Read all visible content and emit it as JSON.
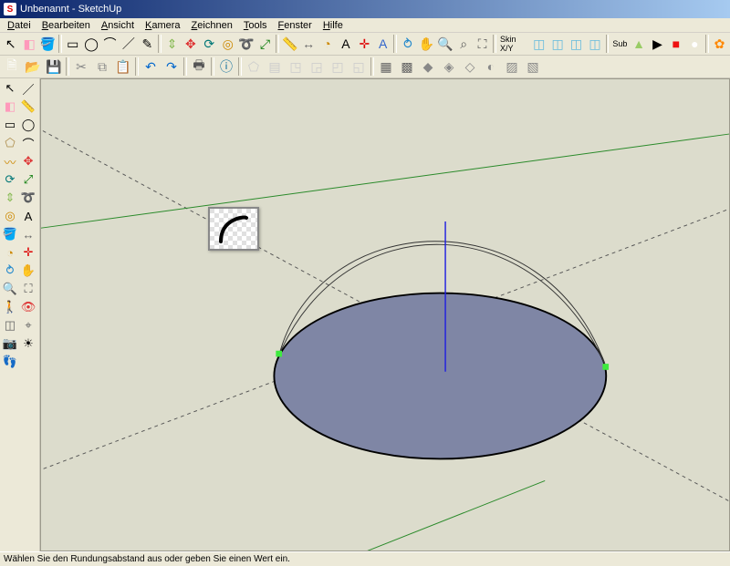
{
  "titlebar": {
    "app_icon": "S",
    "title": "Unbenannt - SketchUp"
  },
  "menu": {
    "items": [
      {
        "label": "Datei",
        "ul": "D"
      },
      {
        "label": "Bearbeiten",
        "ul": "B"
      },
      {
        "label": "Ansicht",
        "ul": "A"
      },
      {
        "label": "Kamera",
        "ul": "K"
      },
      {
        "label": "Zeichnen",
        "ul": "Z"
      },
      {
        "label": "Tools",
        "ul": "T"
      },
      {
        "label": "Fenster",
        "ul": "F"
      },
      {
        "label": "Hilfe",
        "ul": "H"
      }
    ]
  },
  "toolbar1": {
    "groups": [
      {
        "label": "",
        "tools": [
          {
            "name": "select-arrow",
            "glyph": "↖",
            "color": "#000"
          },
          {
            "name": "eraser",
            "glyph": "◧",
            "color": "#f9b"
          },
          {
            "name": "paint-bucket",
            "glyph": "🪣",
            "color": "#c96"
          }
        ]
      },
      {
        "tools": [
          {
            "name": "rectangle",
            "glyph": "▭",
            "color": "#000"
          },
          {
            "name": "circle",
            "glyph": "◯",
            "color": "#000"
          },
          {
            "name": "arc",
            "glyph": "⌒",
            "color": "#000"
          },
          {
            "name": "line",
            "glyph": "／",
            "color": "#000"
          },
          {
            "name": "freehand",
            "glyph": "✎",
            "color": "#000"
          }
        ]
      },
      {
        "tools": [
          {
            "name": "push-pull",
            "glyph": "⇕",
            "color": "#8b5"
          },
          {
            "name": "move",
            "glyph": "✥",
            "color": "#d33"
          },
          {
            "name": "rotate",
            "glyph": "⟳",
            "color": "#077"
          },
          {
            "name": "offset",
            "glyph": "◎",
            "color": "#c80"
          },
          {
            "name": "follow-me",
            "glyph": "➰",
            "color": "#a50"
          },
          {
            "name": "scale",
            "glyph": "⤢",
            "color": "#070"
          }
        ]
      },
      {
        "tools": [
          {
            "name": "tape",
            "glyph": "📏",
            "color": "#cc0"
          },
          {
            "name": "dimension",
            "glyph": "↔",
            "color": "#666"
          },
          {
            "name": "protractor",
            "glyph": "◔",
            "color": "#c80"
          },
          {
            "name": "text",
            "glyph": "A",
            "color": "#000"
          },
          {
            "name": "axes",
            "glyph": "✛",
            "color": "#d00"
          },
          {
            "name": "3dtext",
            "glyph": "A",
            "color": "#36c"
          }
        ]
      },
      {
        "tools": [
          {
            "name": "orbit",
            "glyph": "⥁",
            "color": "#28c"
          },
          {
            "name": "pan",
            "glyph": "✋",
            "color": "#fb0"
          },
          {
            "name": "zoom",
            "glyph": "🔍",
            "color": "#555"
          },
          {
            "name": "zoom-window",
            "glyph": "⌕",
            "color": "#555"
          },
          {
            "name": "zoom-extents",
            "glyph": "⛶",
            "color": "#555"
          }
        ]
      },
      {
        "label": "Skin X/Y",
        "tools": [
          {
            "name": "skin-1",
            "glyph": "◫",
            "color": "#6bd"
          },
          {
            "name": "skin-2",
            "glyph": "◫",
            "color": "#6bd"
          },
          {
            "name": "skin-3",
            "glyph": "◫",
            "color": "#6bd"
          },
          {
            "name": "skin-4",
            "glyph": "◫",
            "color": "#6bd"
          }
        ]
      },
      {
        "label": "Sub",
        "tools": [
          {
            "name": "sub-1",
            "glyph": "▲",
            "color": "#9c6"
          },
          {
            "name": "sub-2",
            "glyph": "▶",
            "color": "#000"
          },
          {
            "name": "sub-3",
            "glyph": "■",
            "color": "#e11"
          },
          {
            "name": "sub-4",
            "glyph": "●",
            "color": "#fff"
          }
        ]
      },
      {
        "tools": [
          {
            "name": "plugin-gear",
            "glyph": "✿",
            "color": "#f80"
          }
        ]
      }
    ]
  },
  "toolbar2": {
    "tools": [
      {
        "name": "new-file",
        "glyph": "🗎",
        "color": "#fff"
      },
      {
        "name": "open-file",
        "glyph": "📂",
        "color": "#fc6"
      },
      {
        "name": "save-file",
        "glyph": "💾",
        "color": "#36c"
      },
      {
        "name": "sep"
      },
      {
        "name": "cut",
        "glyph": "✂",
        "color": "#888"
      },
      {
        "name": "copy",
        "glyph": "⧉",
        "color": "#888"
      },
      {
        "name": "paste",
        "glyph": "📋",
        "color": "#c96"
      },
      {
        "name": "sep"
      },
      {
        "name": "undo",
        "glyph": "↶",
        "color": "#06c"
      },
      {
        "name": "redo",
        "glyph": "↷",
        "color": "#06c"
      },
      {
        "name": "sep"
      },
      {
        "name": "print",
        "glyph": "🖶",
        "color": "#555"
      },
      {
        "name": "sep"
      },
      {
        "name": "model-info",
        "glyph": "ⓘ",
        "color": "#069"
      },
      {
        "name": "sep"
      },
      {
        "name": "iso",
        "glyph": "⬠",
        "color": "#ccc"
      },
      {
        "name": "top",
        "glyph": "▤",
        "color": "#ccc"
      },
      {
        "name": "front",
        "glyph": "◳",
        "color": "#ccc"
      },
      {
        "name": "right",
        "glyph": "◲",
        "color": "#ccc"
      },
      {
        "name": "back",
        "glyph": "◰",
        "color": "#ccc"
      },
      {
        "name": "left",
        "glyph": "◱",
        "color": "#ccc"
      },
      {
        "name": "sep"
      },
      {
        "name": "wireframe",
        "glyph": "▦",
        "color": "#666"
      },
      {
        "name": "hidden-line",
        "glyph": "▩",
        "color": "#666"
      },
      {
        "name": "shaded",
        "glyph": "◆",
        "color": "#888"
      },
      {
        "name": "shaded-tex",
        "glyph": "◈",
        "color": "#888"
      },
      {
        "name": "xray",
        "glyph": "◇",
        "color": "#888"
      },
      {
        "name": "monochrome",
        "glyph": "◐",
        "color": "#888"
      },
      {
        "name": "style2",
        "glyph": "▨",
        "color": "#888"
      },
      {
        "name": "style3",
        "glyph": "▧",
        "color": "#888"
      }
    ]
  },
  "palette": {
    "rows": [
      [
        {
          "name": "select",
          "glyph": "↖",
          "c": "#000"
        },
        {
          "name": "line",
          "glyph": "／",
          "c": "#000"
        }
      ],
      [
        {
          "name": "eraser",
          "glyph": "◧",
          "c": "#f9b"
        },
        {
          "name": "tape",
          "glyph": "📏",
          "c": "#cc0"
        }
      ],
      [
        {
          "name": "rect",
          "glyph": "▭",
          "c": "#000"
        },
        {
          "name": "circle",
          "glyph": "◯",
          "c": "#000"
        }
      ],
      [
        {
          "name": "poly",
          "glyph": "⬠",
          "c": "#a84"
        },
        {
          "name": "arc",
          "glyph": "⌒",
          "c": "#000"
        }
      ],
      [
        {
          "name": "freehand",
          "glyph": "〰",
          "c": "#c80"
        },
        {
          "name": "move",
          "glyph": "✥",
          "c": "#d33"
        }
      ],
      [
        {
          "name": "rotate",
          "glyph": "⟳",
          "c": "#077"
        },
        {
          "name": "scale",
          "glyph": "⤢",
          "c": "#070"
        }
      ],
      [
        {
          "name": "push",
          "glyph": "⇕",
          "c": "#8b5"
        },
        {
          "name": "follow",
          "glyph": "➰",
          "c": "#a50"
        }
      ],
      [
        {
          "name": "offset",
          "glyph": "◎",
          "c": "#c80"
        },
        {
          "name": "text",
          "glyph": "A",
          "c": "#000"
        }
      ],
      [
        {
          "name": "paint",
          "glyph": "🪣",
          "c": "#c96"
        },
        {
          "name": "dim",
          "glyph": "↔",
          "c": "#666"
        }
      ],
      [
        {
          "name": "protractor",
          "glyph": "◔",
          "c": "#c80"
        },
        {
          "name": "axes",
          "glyph": "✛",
          "c": "#d00"
        }
      ],
      [
        {
          "name": "orbit",
          "glyph": "⥁",
          "c": "#28c"
        },
        {
          "name": "pan",
          "glyph": "✋",
          "c": "#fb0"
        }
      ],
      [
        {
          "name": "zoom",
          "glyph": "🔍",
          "c": "#555"
        },
        {
          "name": "zoom-ext",
          "glyph": "⛶",
          "c": "#555"
        }
      ],
      [
        {
          "name": "walk",
          "glyph": "🚶",
          "c": "#d33"
        },
        {
          "name": "look",
          "glyph": "👁",
          "c": "#d33"
        }
      ],
      [
        {
          "name": "section",
          "glyph": "◫",
          "c": "#666"
        },
        {
          "name": "position",
          "glyph": "⌖",
          "c": "#666"
        }
      ],
      [
        {
          "name": "camera",
          "glyph": "📷",
          "c": "#000"
        },
        {
          "name": "shadows",
          "glyph": "☀",
          "c": "#000"
        }
      ],
      [
        {
          "name": "footprints",
          "glyph": "👣",
          "c": "#000"
        },
        {
          "name": "",
          "glyph": "",
          "c": ""
        }
      ]
    ]
  },
  "statusbar": {
    "hint": "Wählen Sie den Rundungsabstand aus oder geben Sie einen Wert ein."
  }
}
